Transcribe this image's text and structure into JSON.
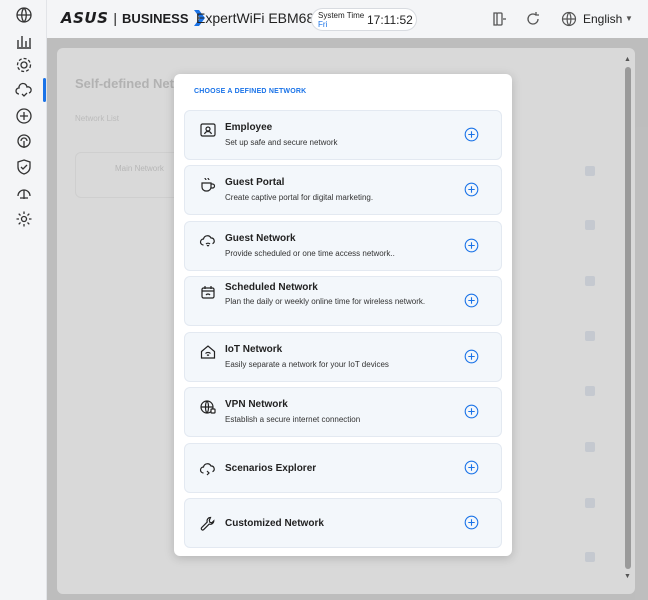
{
  "header": {
    "brand": "ASUS",
    "brand_suffix": "BUSINESS",
    "model": "ExpertWiFi EBM68",
    "system_time_label": "System Time",
    "day": "Fri",
    "time": "17:11:52",
    "language": "English"
  },
  "background": {
    "title": "Self-defined Network",
    "subtitle": "Network List",
    "box_label": "Main Network"
  },
  "modal": {
    "title": "CHOOSE A DEFINED NETWORK",
    "options": [
      {
        "title": "Employee",
        "desc": "Set up safe and secure network",
        "icon": "id-card-icon"
      },
      {
        "title": "Guest Portal",
        "desc": "Create captive portal for digital marketing.",
        "icon": "coffee-cup-icon"
      },
      {
        "title": "Guest Network",
        "desc": "Provide scheduled or one time access network..",
        "icon": "cloud-wifi-icon"
      },
      {
        "title": "Scheduled Network",
        "desc": "Plan the daily or weekly online time for wireless network.",
        "icon": "calendar-wifi-icon"
      },
      {
        "title": "IoT Network",
        "desc": "Easily separate a network for your IoT devices",
        "icon": "home-wifi-icon"
      },
      {
        "title": "VPN Network",
        "desc": "Establish a secure internet connection",
        "icon": "vpn-globe-icon"
      },
      {
        "title": "Scenarios Explorer",
        "desc": "",
        "icon": "explorer-icon"
      },
      {
        "title": "Customized Network",
        "desc": "",
        "icon": "wrench-icon"
      }
    ]
  },
  "colors": {
    "accent": "#1a73e8",
    "option_bg": "#f3f7fb"
  }
}
